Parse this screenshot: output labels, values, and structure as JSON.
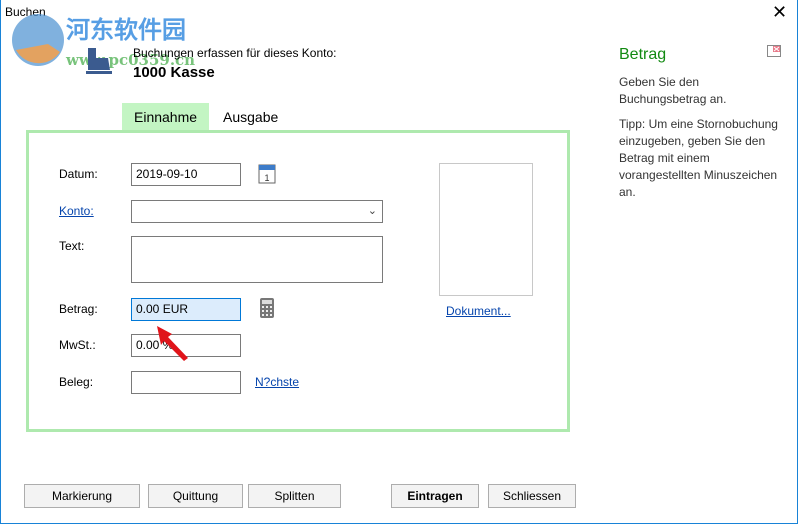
{
  "window": {
    "title": "Buchen",
    "close_icon": "close-icon"
  },
  "watermark": {
    "text": "河东软件园",
    "url": "www.pc0359.cn"
  },
  "header": {
    "caption": "Buchungen erfassen für dieses Konto:",
    "account": "1000 Kasse"
  },
  "tabs": [
    {
      "label": "Einnahme",
      "active": true
    },
    {
      "label": "Ausgabe",
      "active": false
    }
  ],
  "form": {
    "datum": {
      "label": "Datum:",
      "value": "2019-09-10"
    },
    "konto": {
      "label": "Konto:",
      "value": ""
    },
    "text": {
      "label": "Text:",
      "value": ""
    },
    "betrag": {
      "label": "Betrag:",
      "value": "0.00 EUR"
    },
    "mwst": {
      "label": "MwSt.:",
      "value": "0.00 %"
    },
    "beleg": {
      "label": "Beleg:",
      "value": "",
      "next_link": "N?chste"
    },
    "dokument_link": "Dokument..."
  },
  "help": {
    "title": "Betrag",
    "text1": "Geben Sie den Buchungsbetrag an.",
    "text2": "Tipp: Um eine Stornobuchung einzugeben, geben Sie den Betrag mit einem vorangestellten Minuszeichen an."
  },
  "buttons": {
    "markierung": "Markierung",
    "quittung": "Quittung",
    "splitten": "Splitten",
    "eintragen": "Eintragen",
    "schliessen": "Schliessen"
  },
  "colors": {
    "accent": "#1883d7",
    "tab_active": "#c3f5c3",
    "help_title": "#128a12"
  }
}
